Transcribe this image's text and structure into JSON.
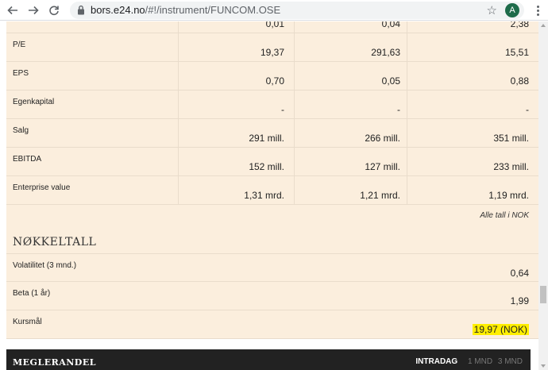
{
  "browser": {
    "url_host": "bors.e24.no",
    "url_path": "/#!/instrument/FUNCOM.OSE",
    "avatar_letter": "A"
  },
  "key_figures": {
    "top_partial_values": [
      "0,01",
      "0,04",
      "2,38"
    ],
    "rows": [
      {
        "label": "P/E",
        "values": [
          "19,37",
          "291,63",
          "15,51"
        ]
      },
      {
        "label": "EPS",
        "values": [
          "0,70",
          "0,05",
          "0,88"
        ]
      },
      {
        "label": "Egenkapital",
        "values": [
          "-",
          "-",
          "-"
        ]
      },
      {
        "label": "Salg",
        "values": [
          "291 mill.",
          "266 mill.",
          "351 mill."
        ]
      },
      {
        "label": "EBITDA",
        "values": [
          "152 mill.",
          "127 mill.",
          "233 mill."
        ]
      },
      {
        "label": "Enterprise value",
        "values": [
          "1,31 mrd.",
          "1,21 mrd.",
          "1,19 mrd."
        ]
      }
    ],
    "note": "Alle tall i NOK"
  },
  "nokkeltall": {
    "title": "NØKKELTALL",
    "rows": [
      {
        "label": "Volatilitet (3 mnd.)",
        "value": "0,64"
      },
      {
        "label": "Beta (1 år)",
        "value": "1,99"
      },
      {
        "label": "Kursmål",
        "value": "19,97 (NOK)"
      }
    ]
  },
  "meglerandel": {
    "title": "MEGLERANDEL",
    "tabs": [
      "INTRADAG",
      "1 MND",
      "3 MND"
    ]
  },
  "colors": {
    "panel_bg": "#fbeedd",
    "highlight": "#ffee00",
    "bar_bg": "#222222"
  }
}
